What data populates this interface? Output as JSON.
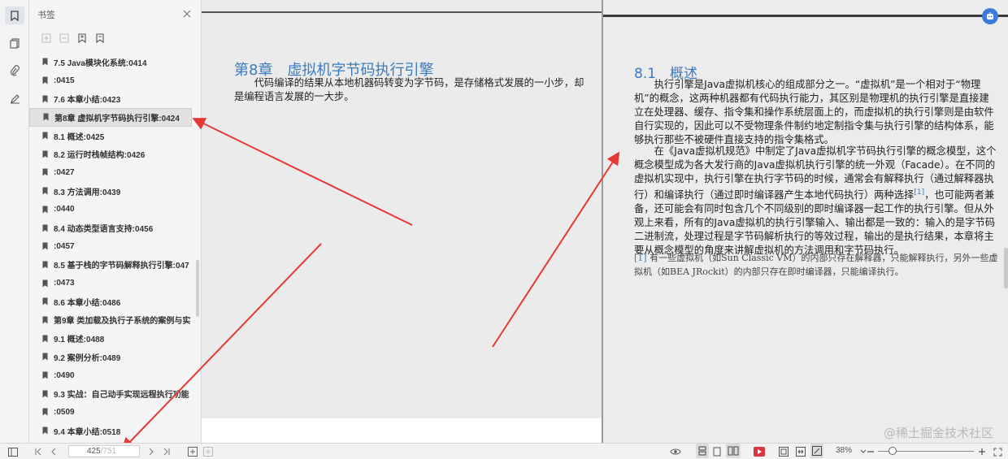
{
  "sidebar": {
    "title": "书签",
    "items": [
      {
        "label": "7.5 Java模块化系统:0414"
      },
      {
        "label": ":0415"
      },
      {
        "label": "7.6 本章小结:0423"
      },
      {
        "label": "第8章 虚拟机字节码执行引擎:0424",
        "selected": true
      },
      {
        "label": "8.1 概述:0425"
      },
      {
        "label": "8.2 运行时栈帧结构:0426"
      },
      {
        "label": ":0427"
      },
      {
        "label": "8.3 方法调用:0439"
      },
      {
        "label": ":0440"
      },
      {
        "label": "8.4 动态类型语言支持:0456"
      },
      {
        "label": ":0457"
      },
      {
        "label": "8.5 基于栈的字节码解释执行引擎:047"
      },
      {
        "label": ":0473"
      },
      {
        "label": "8.6 本章小结:0486"
      },
      {
        "label": "第9章 类加载及执行子系统的案例与实"
      },
      {
        "label": "9.1 概述:0488"
      },
      {
        "label": "9.2 案例分析:0489"
      },
      {
        "label": ":0490"
      },
      {
        "label": "9.3 实战：自己动手实现远程执行功能"
      },
      {
        "label": ":0509"
      },
      {
        "label": "9.4 本章小结:0518"
      }
    ]
  },
  "doc": {
    "left_page": {
      "chapter_title": "第8章　虚拟机字节码执行引擎",
      "intro": "代码编译的结果从本地机器码转变为字节码，是存储格式发展的一小步，却是编程语言发展的一大步。"
    },
    "right_page": {
      "section_title": "8.1　概述",
      "para1": "执行引擎是Java虚拟机核心的组成部分之一。“虚拟机”是一个相对于“物理机”的概念，这两种机器都有代码执行能力，其区别是物理机的执行引擎是直接建立在处理器、缓存、指令集和操作系统层面上的，而虚拟机的执行引擎则是由软件自行实现的，因此可以不受物理条件制约地定制指令集与执行引擎的结构体系，能够执行那些不被硬件直接支持的指令集格式。",
      "para2_a": "在《Java虚拟机规范》中制定了Java虚拟机字节码执行引擎的概念模型，这个概念模型成为各大发行商的Java虚拟机执行引擎的统一外观（Facade）。在不同的虚拟机实现中，执行引擎在执行字节码的时候，通常会有解释执行（通过解释器执行）和编译执行（通过即时编译器产生本地代码执行）两种选择",
      "para2_sup": "[1]",
      "para2_b": "，也可能两者兼备，还可能会有同时包含几个不同级别的即时编译器一起工作的执行引擎。但从外观上来看，所有的Java虚拟机的执行引擎输入、输出都是一致的：输入的是字节码二进制流，处理过程是字节码解析执行的等效过程，输出的是执行结果，本章将主要从概念模型的角度来讲解虚拟机的方法调用和字节码执行。",
      "footnote_ref": "[1]",
      "footnote": " 有一些虚拟机（如Sun Classic VM）的内部只存在解释器，只能解释执行，另外一些虚拟机（如BEA JRockit）的内部只存在即时编译器，只能编译执行。"
    }
  },
  "footer": {
    "current_page": "425",
    "total_pages": "/751",
    "zoom": "38%",
    "zoom_level": 0.15,
    "watermark": "@稀土掘金技术社区"
  },
  "colors": {
    "accent": "#3a7bbf",
    "arrow": "#e53935",
    "fab": "#3a7bdc",
    "record": "#d9363e"
  }
}
